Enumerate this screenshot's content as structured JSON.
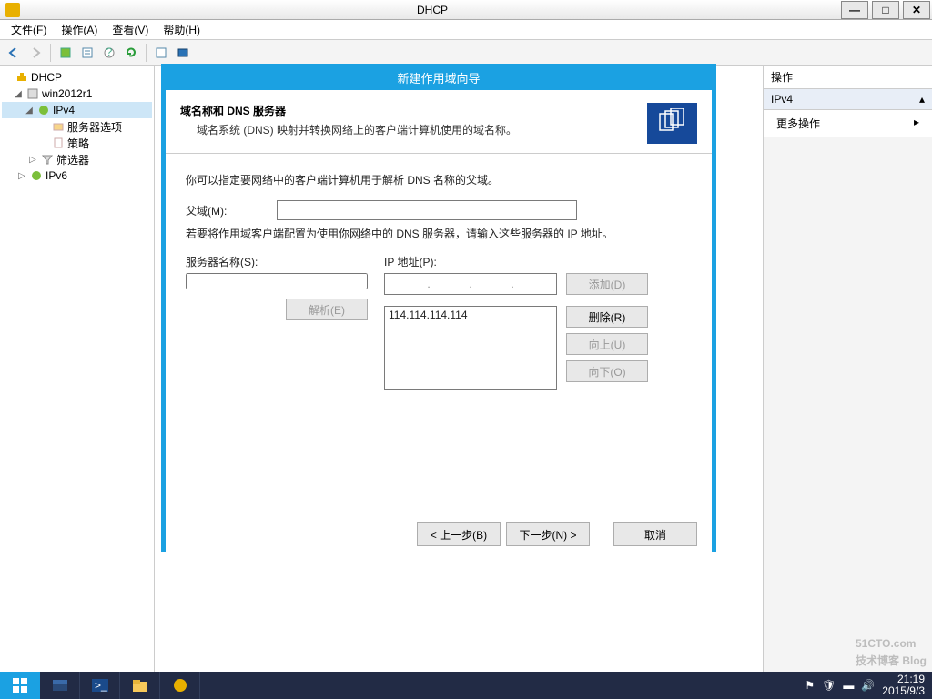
{
  "window": {
    "title": "DHCP"
  },
  "menubar": {
    "file": "文件(F)",
    "action": "操作(A)",
    "view": "查看(V)",
    "help": "帮助(H)"
  },
  "tree": {
    "root": "DHCP",
    "server": "win2012r1",
    "ipv4": "IPv4",
    "server_options": "服务器选项",
    "policies": "策略",
    "filters": "筛选器",
    "ipv6": "IPv6"
  },
  "actions_panel": {
    "title": "操作",
    "section": "IPv4",
    "more": "更多操作"
  },
  "wizard": {
    "title": "新建作用域向导",
    "heading": "域名称和 DNS 服务器",
    "subheading": "域名系统 (DNS) 映射并转换网络上的客户端计算机使用的域名称。",
    "instr1": "你可以指定要网络中的客户端计算机用于解析 DNS 名称的父域。",
    "parent_label": "父域(M):",
    "parent_value": "",
    "instr2": "若要将作用域客户端配置为使用你网络中的 DNS 服务器，请输入这些服务器的 IP 地址。",
    "server_name_label": "服务器名称(S):",
    "server_name_value": "",
    "resolve_btn": "解析(E)",
    "ip_label": "IP 地址(P):",
    "add_btn": "添加(D)",
    "remove_btn": "删除(R)",
    "up_btn": "向上(U)",
    "down_btn": "向下(O)",
    "ip_list": [
      "114.114.114.114"
    ],
    "prev_btn": "< 上一步(B)",
    "next_btn": "下一步(N) >",
    "cancel_btn": "取消"
  },
  "taskbar": {
    "time": "21:19",
    "date": "2015/9/3"
  },
  "watermark": {
    "top": "51CTO.com",
    "bottom": "技术博客  Blog"
  }
}
